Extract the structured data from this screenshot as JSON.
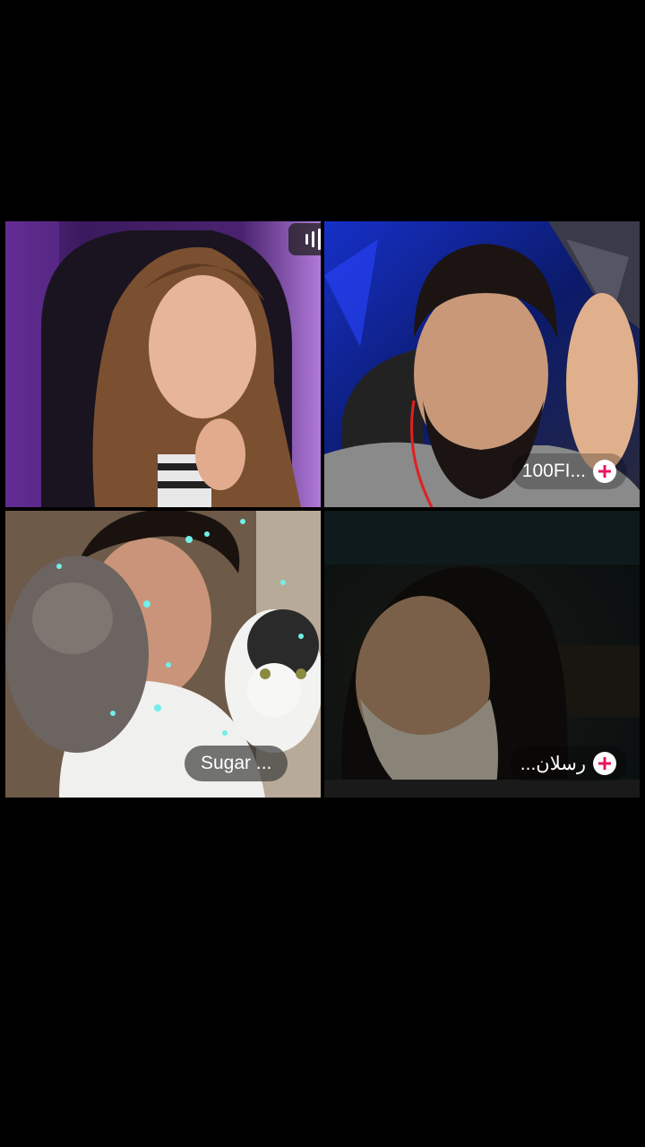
{
  "call": {
    "audio_icon": "audio-level-icon",
    "participants": [
      {
        "name": "",
        "add_icon": ""
      },
      {
        "name": "100FI...",
        "add_icon": "plus-circle-icon"
      },
      {
        "name": "Sugar ...",
        "add_icon": ""
      },
      {
        "name": "رسلان...",
        "add_icon": "plus-circle-icon"
      }
    ]
  },
  "colors": {
    "background": "#000000",
    "follow_accent": "#e8175d",
    "label_text": "#ffffff"
  }
}
